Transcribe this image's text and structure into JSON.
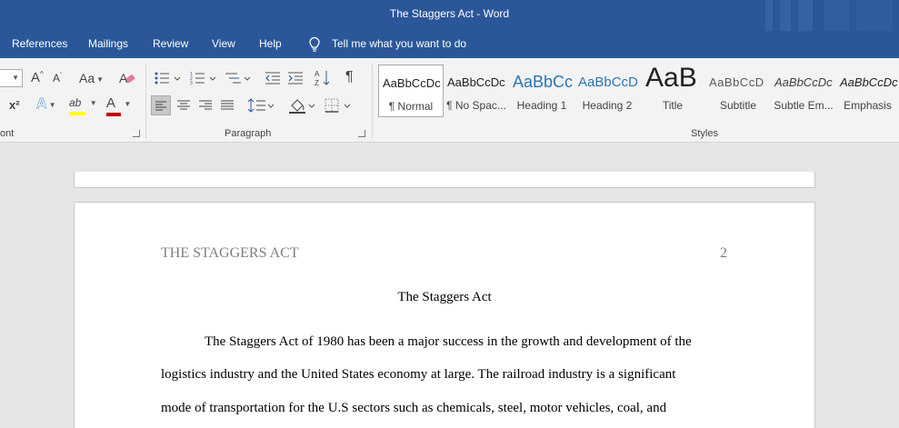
{
  "window": {
    "title": "The Staggers Act  -  Word"
  },
  "tabs": [
    "References",
    "Mailings",
    "Review",
    "View",
    "Help"
  ],
  "tell_me": "Tell me what you want to do",
  "ribbon": {
    "font_group_label": "ont",
    "paragraph_group_label": "Paragraph",
    "styles_group_label": "Styles",
    "font_buttons": {
      "grow": "A",
      "shrink": "A",
      "change_case": "Aa",
      "superscript": "x²",
      "text_effects": "A",
      "highlight": "ab",
      "font_color": "A"
    },
    "pilcrow": "¶",
    "styles": [
      {
        "sample": "AaBbCcDc",
        "name": "¶ Normal",
        "selected": true
      },
      {
        "sample": "AaBbCcDc",
        "name": "¶ No Spac..."
      },
      {
        "sample": "AaBbCc",
        "name": "Heading 1"
      },
      {
        "sample": "AaBbCcD",
        "name": "Heading 2"
      },
      {
        "sample": "AaB",
        "name": "Title"
      },
      {
        "sample": "AaBbCcD",
        "name": "Subtitle"
      },
      {
        "sample": "AaBbCcDc",
        "name": "Subtle Em..."
      },
      {
        "sample": "AaBbCcDc",
        "name": "Emphasis"
      }
    ]
  },
  "colors": {
    "brand": "#2b579a",
    "highlight": "#ffff00",
    "font_color": "#c00000"
  },
  "document": {
    "running_head": "THE STAGGERS ACT",
    "page_number": "2",
    "title": "The Staggers Act",
    "lines": [
      "The Staggers Act of 1980 has been a major success in the growth and development of the",
      "logistics industry and the United States economy at large. The railroad industry is a significant",
      "mode of transportation for the U.S sectors such as chemicals, steel, motor vehicles, coal, and"
    ]
  }
}
